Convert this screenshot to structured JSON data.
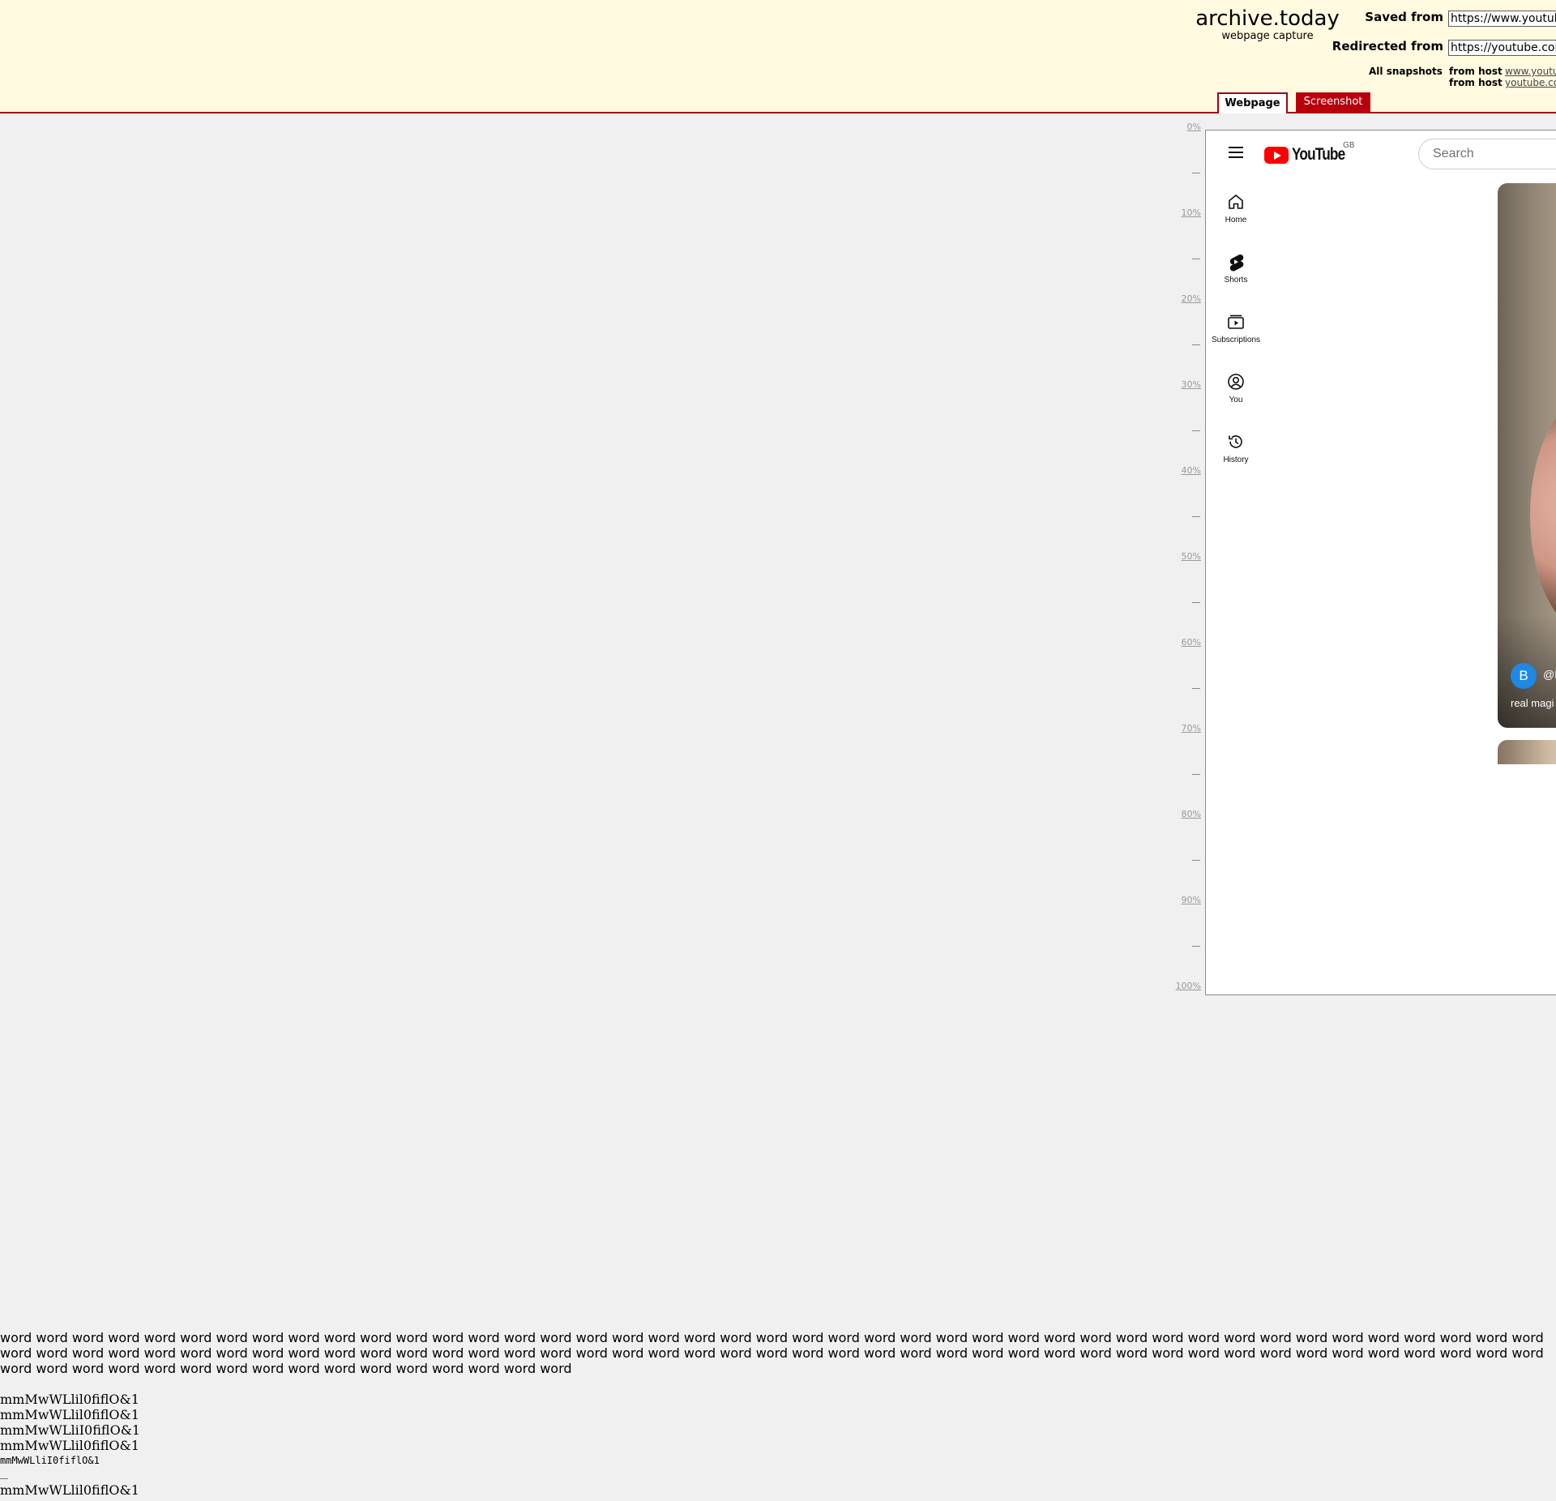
{
  "archive": {
    "title": "archive.today",
    "subtitle": "webpage capture",
    "saved_from_label": "Saved from",
    "saved_from_url": "https://www.youtube",
    "redirected_from_label": "Redirected from",
    "redirected_from_url": "https://youtube.com",
    "all_snapshots_label": "All snapshots",
    "from_host_label_1": "from host",
    "host_1": "www.youtu",
    "from_host_label_2": "from host",
    "host_2": "youtube.co",
    "tabs": {
      "webpage": "Webpage",
      "screenshot": "Screenshot"
    },
    "accent_color": "#a0001c"
  },
  "ruler": {
    "labels": [
      "0%",
      "10%",
      "20%",
      "30%",
      "40%",
      "50%",
      "60%",
      "70%",
      "80%",
      "90%",
      "100%"
    ],
    "dash": "—"
  },
  "youtube": {
    "logo_text": "YouTube",
    "country": "GB",
    "search_placeholder": "Search",
    "nav": [
      {
        "label": "Home",
        "icon": "home-icon"
      },
      {
        "label": "Shorts",
        "icon": "shorts-icon"
      },
      {
        "label": "Subscriptions",
        "icon": "subscriptions-icon"
      },
      {
        "label": "You",
        "icon": "you-icon"
      },
      {
        "label": "History",
        "icon": "history-icon"
      }
    ],
    "short": {
      "avatar_letter": "B",
      "handle": "@B",
      "title": "real magi"
    }
  },
  "font_samples": {
    "words": "word word word word word word word word word word word word word word word word word word word word word word word word word word word word word word word word word word word word word word word word word word word word word word word word word word word word word word word word word word word word word word word word word word word word word word word word word word word word word word word word word word word word word word word word word word word word word word word word word word word word word word",
    "sample_1": "mmMwWLlil0fiflO&1",
    "sample_2": "mmMwWLlil0fiflO&1",
    "sample_3": "mmMwWLliI0fiflO&1",
    "sample_4": "mmMwWLlil0fiflO&1",
    "sample_5": "mmMwWLliI0fiflO&1",
    "sample_6": "mmMwWLlil0fiflO&1"
  }
}
